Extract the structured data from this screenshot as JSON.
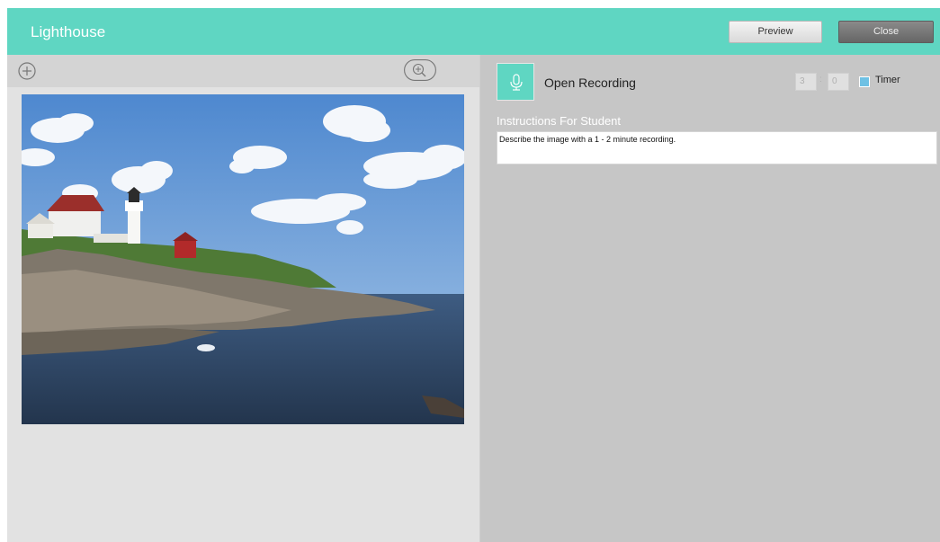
{
  "header": {
    "title": "Lighthouse",
    "preview_label": "Preview",
    "close_label": "Close",
    "accent_color": "#5fd6c2"
  },
  "left_toolbar": {
    "add_icon": "plus-circle-icon",
    "zoom_icon": "zoom-in-icon"
  },
  "image": {
    "description_icon": "lighthouse-photo"
  },
  "recording": {
    "icon": "microphone-icon",
    "label": "Open Recording",
    "timer_minutes": "3",
    "timer_seconds": "0",
    "timer_separator": ":",
    "timer_label": "Timer",
    "timer_checked": true
  },
  "instructions": {
    "title": "Instructions For Student",
    "text": "Describe the image with a 1 - 2 minute recording."
  }
}
